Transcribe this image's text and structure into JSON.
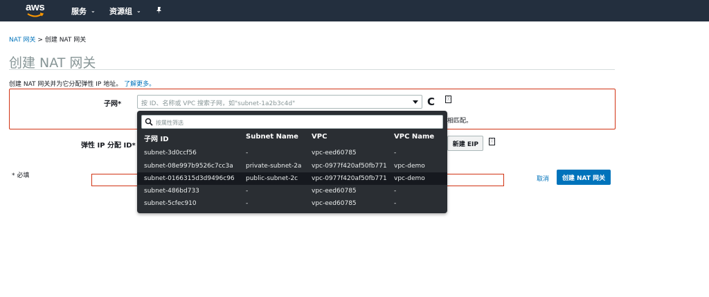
{
  "nav": {
    "logo": "aws",
    "services": "服务",
    "resource_groups": "资源组",
    "pin": "✦"
  },
  "breadcrumb": {
    "parent": "NAT 网关",
    "separator": " > ",
    "current": "创建 NAT 网关"
  },
  "page": {
    "title": "创建 NAT 网关",
    "description": "创建 NAT 网关并为它分配弹性 IP 地址。",
    "learn_more": "了解更多。"
  },
  "form": {
    "subnet_label": "子网*",
    "subnet_placeholder": "按 ID、名称或 VPC 搜索子网，如\"subnet-1a2b3c4d\"",
    "match_text": "相匹配。",
    "eip_label": "弹性 IP 分配 ID*",
    "create_eip_button": "新建 EIP",
    "info_icon": "ⓘ",
    "refresh_icon": "C"
  },
  "footer": {
    "required": "* 必填",
    "cancel": "取消",
    "create_button": "创建 NAT 网关"
  },
  "dropdown": {
    "filter_placeholder": "按属性筛选",
    "headers": [
      "子网 ID",
      "Subnet Name",
      "VPC",
      "VPC Name"
    ],
    "rows": [
      {
        "id": "subnet-3d0ccf56",
        "name": "-",
        "vpc": "vpc-eed60785",
        "vpc_name": "-"
      },
      {
        "id": "subnet-08e997b9526c7cc3a",
        "name": "private-subnet-2a",
        "vpc": "vpc-0977f420af50fb771",
        "vpc_name": "vpc-demo"
      },
      {
        "id": "subnet-0166315d3d9496c96",
        "name": "public-subnet-2c",
        "vpc": "vpc-0977f420af50fb771",
        "vpc_name": "vpc-demo"
      },
      {
        "id": "subnet-486bd733",
        "name": "-",
        "vpc": "vpc-eed60785",
        "vpc_name": "-"
      },
      {
        "id": "subnet-5cfec910",
        "name": "-",
        "vpc": "vpc-eed60785",
        "vpc_name": "-"
      }
    ]
  },
  "colors": {
    "nav_bg": "#232f3e",
    "link": "#0073bb",
    "error_border": "#d13212",
    "dropdown_bg": "#2a2e33",
    "primary_button": "#0073bb"
  }
}
